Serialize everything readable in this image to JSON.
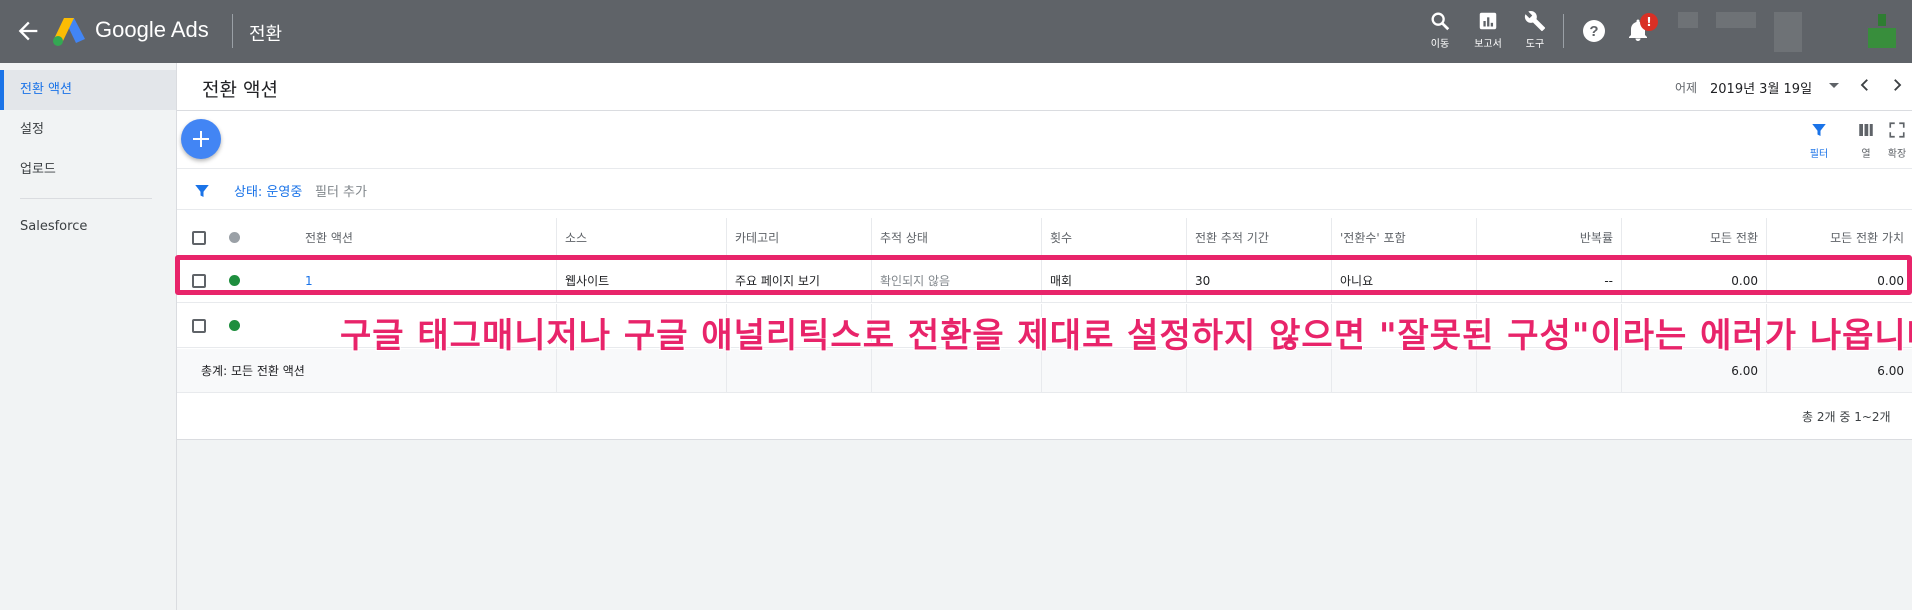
{
  "topbar": {
    "brand": "Google Ads",
    "section": "전환",
    "tools": [
      {
        "icon": "search-icon",
        "label": "이동"
      },
      {
        "icon": "reports-icon",
        "label": "보고서"
      },
      {
        "icon": "wrench-icon",
        "label": "도구"
      }
    ],
    "notification_count": "!",
    "colors": {
      "bar": "#5f6368",
      "badge": "#d93025"
    }
  },
  "sidebar": {
    "items": [
      {
        "label": "전환 액션",
        "active": true
      },
      {
        "label": "설정"
      },
      {
        "label": "업로드"
      },
      {
        "label": "Salesforce"
      }
    ]
  },
  "header": {
    "title": "전환 액션",
    "date_label": "어제",
    "date_value": "2019년 3월 19일"
  },
  "toolbar": {
    "controls": [
      {
        "icon": "filter-icon",
        "label": "필터"
      },
      {
        "icon": "columns-icon",
        "label": "열"
      },
      {
        "icon": "expand-icon",
        "label": "확장"
      }
    ]
  },
  "filters": {
    "chip": "상태: 운영중",
    "add_label": "필터 추가"
  },
  "table": {
    "columns": [
      "전환 액션",
      "소스",
      "카테고리",
      "추적 상태",
      "횟수",
      "전환 추적 기간",
      "'전환수' 포함",
      "반복률",
      "모든 전환",
      "모든 전환 가치"
    ],
    "rows": [
      {
        "name": "1",
        "source": "웹사이트",
        "category": "주요 페이지 보기",
        "tracking": "확인되지 않음",
        "count": "매회",
        "window": "30",
        "include": "아니요",
        "repeat": "--",
        "all_conv": "0.00",
        "all_value": "0.00",
        "status_color": "#1e8e3e"
      },
      {
        "name": "",
        "source": "",
        "category": "",
        "tracking": "",
        "count": "",
        "window": "",
        "include": "",
        "repeat": "",
        "all_conv": "",
        "all_value": "",
        "status_color": "#1e8e3e"
      }
    ],
    "total_label": "총계: 모든 전환 액션",
    "total_all_conv": "6.00",
    "total_all_value": "6.00"
  },
  "pagination": "총 2개 중 1~2개",
  "annotation": {
    "text": "구글 태그매니저나 구글 애널리틱스로 전환을 제대로 설정하지 않으면 \"잘못된 구성\"이라는 에러가 나옵니다",
    "color": "#e8246a"
  }
}
